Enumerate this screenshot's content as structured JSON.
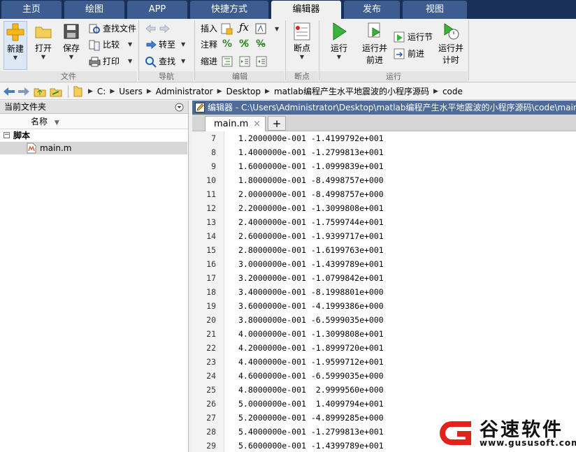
{
  "tabs": [
    "主页",
    "绘图",
    "APP",
    "快捷方式",
    "编辑器",
    "发布",
    "视图"
  ],
  "active_tab": "编辑器",
  "ribbon": {
    "file": {
      "new": "新建",
      "open": "打开",
      "save": "保存",
      "find_files": "查找文件",
      "compare": "比较",
      "print": "打印",
      "group": "文件"
    },
    "nav": {
      "goto": "转至",
      "find": "查找",
      "group": "导航"
    },
    "edit": {
      "insert": "插入",
      "comment": "注释",
      "indent": "缩进",
      "group": "编辑"
    },
    "breakpoints": {
      "bp": "断点",
      "group": "断点"
    },
    "run": {
      "run": "运行",
      "run_advance_1": "运行并",
      "run_advance_2": "前进",
      "run_section": "运行节",
      "advance": "前进",
      "run_time_1": "运行并",
      "run_time_2": "计时",
      "group": "运行"
    }
  },
  "address": [
    "C:",
    "Users",
    "Administrator",
    "Desktop",
    "matlab编程产生水平地震波的小程序源码",
    "code"
  ],
  "left_panel": {
    "title": "当前文件夹",
    "column_name": "名称",
    "group": "脚本",
    "file": "main.m"
  },
  "editor": {
    "title": "编辑器 - C:\\Users\\Administrator\\Desktop\\matlab编程产生水平地震波的小程序源码\\code\\main",
    "tab": "main.m",
    "lines": [
      {
        "n": "7",
        "t": "1.2000000e-001 -1.4199792e+001"
      },
      {
        "n": "8",
        "t": "1.4000000e-001 -1.2799813e+001"
      },
      {
        "n": "9",
        "t": "1.6000000e-001 -1.0999839e+001"
      },
      {
        "n": "10",
        "t": "1.8000000e-001 -8.4998757e+000"
      },
      {
        "n": "11",
        "t": "2.0000000e-001 -8.4998757e+000"
      },
      {
        "n": "12",
        "t": "2.2000000e-001 -1.3099808e+001"
      },
      {
        "n": "13",
        "t": "2.4000000e-001 -1.7599744e+001"
      },
      {
        "n": "14",
        "t": "2.6000000e-001 -1.9399717e+001"
      },
      {
        "n": "15",
        "t": "2.8000000e-001 -1.6199763e+001"
      },
      {
        "n": "16",
        "t": "3.0000000e-001 -1.4399789e+001"
      },
      {
        "n": "17",
        "t": "3.2000000e-001 -1.0799842e+001"
      },
      {
        "n": "18",
        "t": "3.4000000e-001 -8.1998801e+000"
      },
      {
        "n": "19",
        "t": "3.6000000e-001 -4.1999386e+000"
      },
      {
        "n": "20",
        "t": "3.8000000e-001 -6.5999035e+000"
      },
      {
        "n": "21",
        "t": "4.0000000e-001 -1.3099808e+001"
      },
      {
        "n": "22",
        "t": "4.2000000e-001 -1.8999720e+001"
      },
      {
        "n": "23",
        "t": "4.4000000e-001 -1.9599712e+001"
      },
      {
        "n": "24",
        "t": "4.6000000e-001 -6.5999035e+000"
      },
      {
        "n": "25",
        "t": "4.8000000e-001  2.9999560e+000"
      },
      {
        "n": "26",
        "t": "5.0000000e-001  1.4099794e+001"
      },
      {
        "n": "27",
        "t": "5.2000000e-001 -4.8999285e+000"
      },
      {
        "n": "28",
        "t": "5.4000000e-001 -1.2799813e+001"
      },
      {
        "n": "29",
        "t": "5.6000000e-001 -1.4399789e+001"
      }
    ]
  },
  "watermark": {
    "name": "谷速软件",
    "url": "www.gususoft.com",
    "logo": "G"
  },
  "colors": {
    "tabbar": "#19305a",
    "tab": "#3d5c8f",
    "editor_title": "#4e6b99",
    "watermark_red": "#e3221c"
  }
}
